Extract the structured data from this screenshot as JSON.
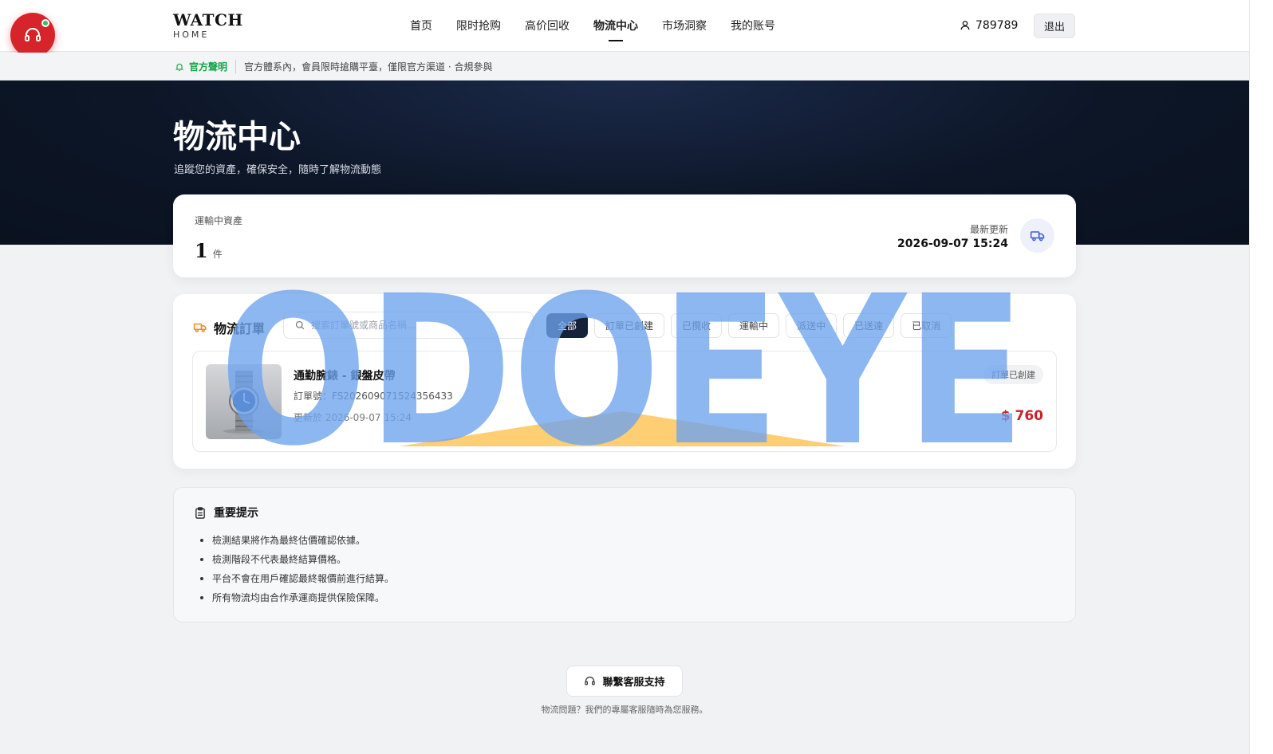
{
  "brand": {
    "name": "WATCH",
    "sub": "HOME"
  },
  "nav": {
    "links": [
      "首页",
      "限时抢购",
      "高价回收",
      "物流中心",
      "市场洞察",
      "我的账号"
    ],
    "active_index": 3,
    "user": "789789",
    "logout": "退出"
  },
  "cs": {
    "label": "客服"
  },
  "notice": {
    "tag": "官方聲明",
    "text": "官方體系內，會員限時搶購平臺，僅限官方渠道 · 合規參與"
  },
  "hero": {
    "title": "物流中心",
    "subtitle": "追蹤您的資產，確保安全，隨時了解物流動態"
  },
  "stats": {
    "label": "運輸中資產",
    "count": "1",
    "unit": "件",
    "updated_label": "最新更新",
    "updated_value": "2026-09-07 15:24"
  },
  "orders": {
    "title": "物流訂單",
    "search_placeholder": "搜索訂單號或商品名稱...",
    "filters": [
      "全部",
      "訂單已創建",
      "已攬收",
      "運輸中",
      "派送中",
      "已送達",
      "已取消"
    ],
    "active_filter": 0,
    "items": [
      {
        "name": "通勤腕錶 - 銀盤皮帶",
        "order_no": "訂單號：FS202609071524356433",
        "updated": "更新於 2026-09-07 15:24",
        "status": "訂單已創建",
        "price": "$ 760"
      }
    ]
  },
  "tips": {
    "title": "重要提示",
    "items": [
      "檢測結果將作為最終估價確認依據。",
      "檢測階段不代表最終結算價格。",
      "平台不會在用戶確認最終報價前進行結算。",
      "所有物流均由合作承運商提供保險保障。"
    ]
  },
  "contact": {
    "button": "聯繫客服支持",
    "note": "物流問題？我們的專屬客服隨時為您服務。"
  },
  "watermark": {
    "text": "ODOEYE"
  },
  "colors": {
    "accent": "#d6242b",
    "dark": "#16213a",
    "price": "#c8222a",
    "notice": "#16a34a",
    "watermark": "#6ea3ee"
  }
}
